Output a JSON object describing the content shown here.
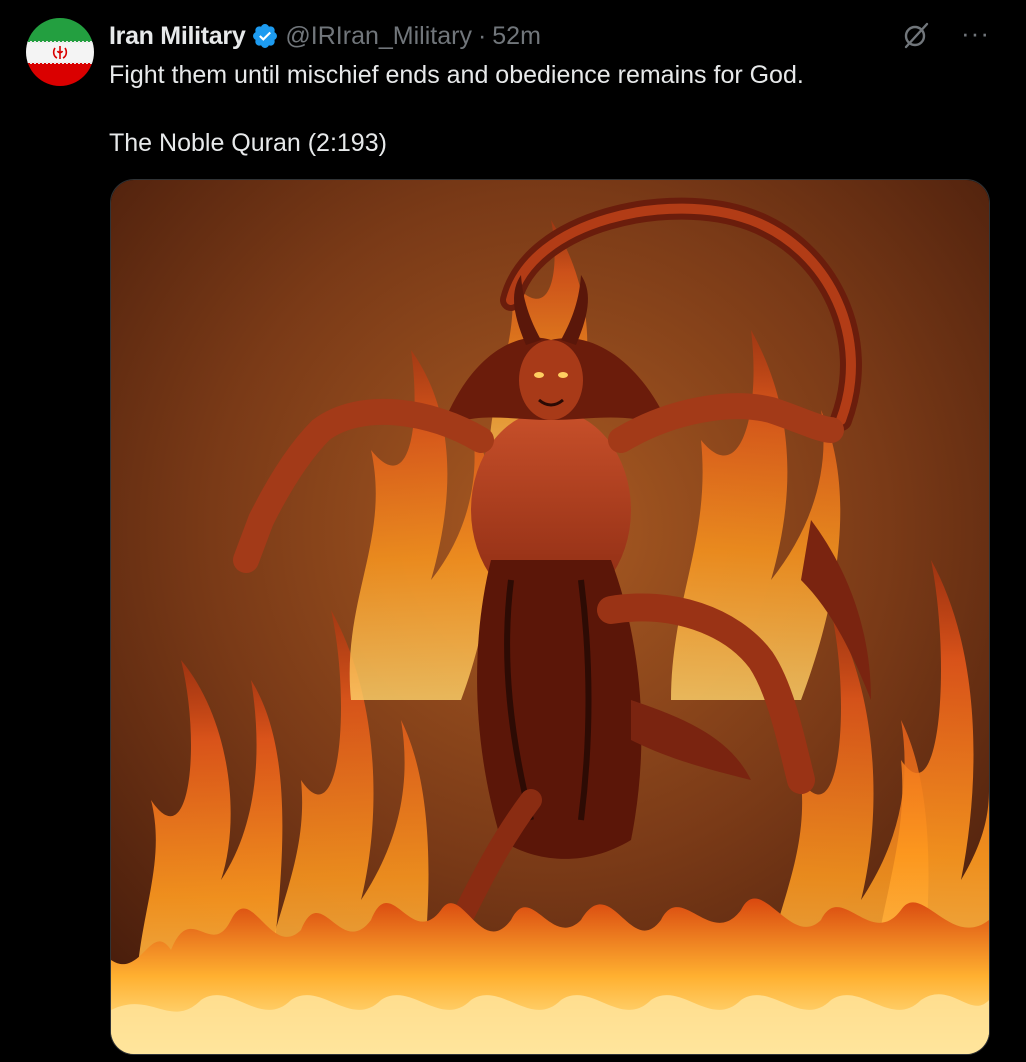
{
  "author": {
    "display_name": "Iran Military",
    "handle": "@IRIran_Military",
    "separator": "·",
    "timestamp": "52m",
    "verified": true,
    "verified_color": "#1d9bf0"
  },
  "tweet": {
    "line1": "Fight them until mischief ends and obedience remains for God.",
    "line2": "The Noble Quran (2:193)"
  },
  "icons": {
    "grok": "grok-slash-circle-icon",
    "more": "more-dots-icon",
    "more_glyph": "···",
    "avatar": "iran-flag-avatar"
  },
  "media": {
    "type": "image",
    "subject": "demon figure surrounded by flames"
  },
  "colors": {
    "background": "#000000",
    "text_primary": "#e7e9ea",
    "text_secondary": "#71767b",
    "flag_green": "#239f40",
    "flag_white": "#ffffff",
    "flag_red": "#da0000"
  }
}
